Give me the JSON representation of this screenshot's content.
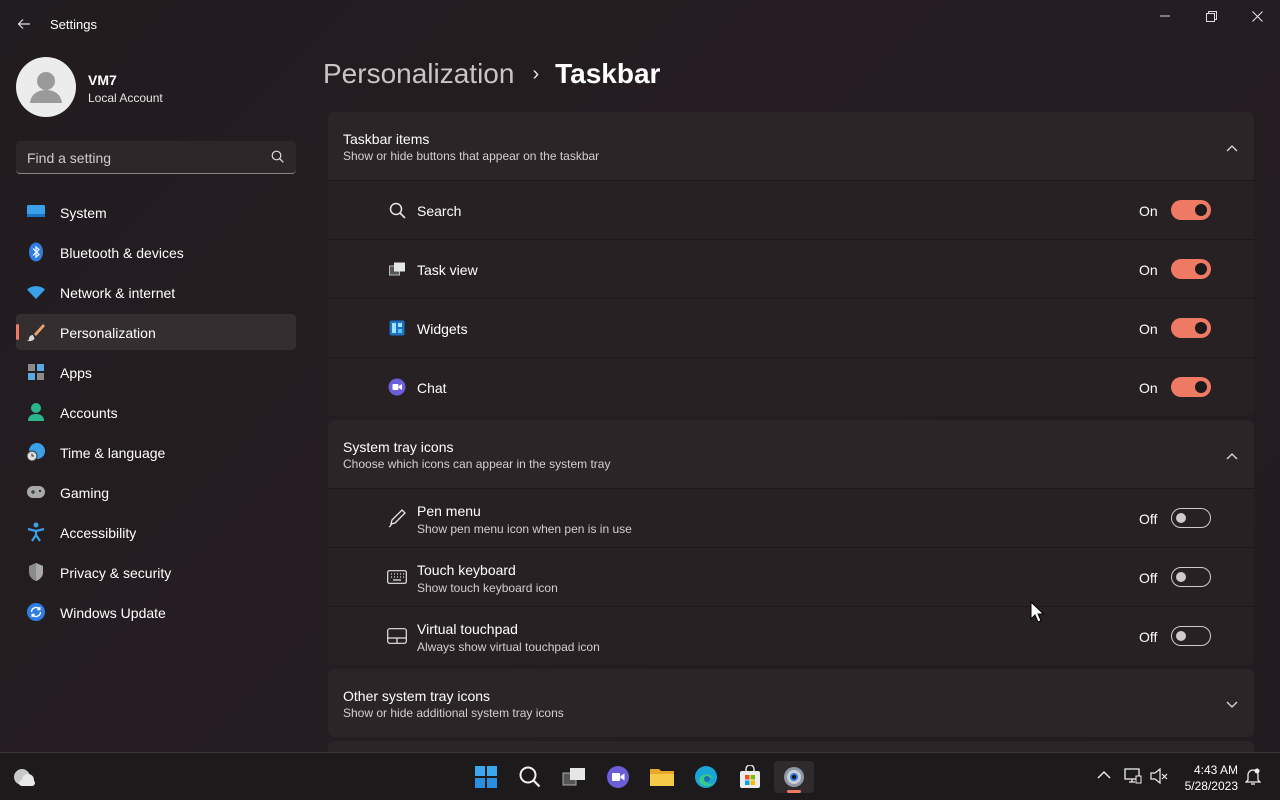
{
  "app": {
    "title": "Settings"
  },
  "user": {
    "name": "VM7",
    "account_type": "Local Account"
  },
  "search": {
    "placeholder": "Find a setting"
  },
  "sidebar": {
    "items": [
      {
        "label": "System",
        "icon": "system-icon",
        "active": false
      },
      {
        "label": "Bluetooth & devices",
        "icon": "bluetooth-icon",
        "active": false
      },
      {
        "label": "Network & internet",
        "icon": "wifi-icon",
        "active": false
      },
      {
        "label": "Personalization",
        "icon": "brush-icon",
        "active": true
      },
      {
        "label": "Apps",
        "icon": "apps-icon",
        "active": false
      },
      {
        "label": "Accounts",
        "icon": "accounts-icon",
        "active": false
      },
      {
        "label": "Time & language",
        "icon": "globe-clock-icon",
        "active": false
      },
      {
        "label": "Gaming",
        "icon": "gamepad-icon",
        "active": false
      },
      {
        "label": "Accessibility",
        "icon": "accessibility-icon",
        "active": false
      },
      {
        "label": "Privacy & security",
        "icon": "shield-icon",
        "active": false
      },
      {
        "label": "Windows Update",
        "icon": "update-icon",
        "active": false
      }
    ]
  },
  "breadcrumb": {
    "parent": "Personalization",
    "separator": "›",
    "current": "Taskbar"
  },
  "sections": {
    "taskbar_items": {
      "title": "Taskbar items",
      "description": "Show or hide buttons that appear on the taskbar",
      "expanded": true,
      "rows": [
        {
          "label": "Search",
          "state": "On",
          "on": true,
          "icon": "search-icon"
        },
        {
          "label": "Task view",
          "state": "On",
          "on": true,
          "icon": "task-view-icon"
        },
        {
          "label": "Widgets",
          "state": "On",
          "on": true,
          "icon": "widgets-icon"
        },
        {
          "label": "Chat",
          "state": "On",
          "on": true,
          "icon": "chat-icon"
        }
      ]
    },
    "system_tray": {
      "title": "System tray icons",
      "description": "Choose which icons can appear in the system tray",
      "expanded": true,
      "rows": [
        {
          "label": "Pen menu",
          "sublabel": "Show pen menu icon when pen is in use",
          "state": "Off",
          "on": false,
          "icon": "pen-icon"
        },
        {
          "label": "Touch keyboard",
          "sublabel": "Show touch keyboard icon",
          "state": "Off",
          "on": false,
          "icon": "keyboard-icon"
        },
        {
          "label": "Virtual touchpad",
          "sublabel": "Always show virtual touchpad icon",
          "state": "Off",
          "on": false,
          "icon": "touchpad-icon"
        }
      ]
    },
    "other_tray": {
      "title": "Other system tray icons",
      "description": "Show or hide additional system tray icons",
      "expanded": false
    }
  },
  "taskbar": {
    "apps": [
      "start-icon",
      "taskbar-search-icon",
      "task-view-icon",
      "teams-chat-icon",
      "file-explorer-icon",
      "edge-icon",
      "store-icon",
      "settings-icon"
    ],
    "active_app": "settings-icon",
    "clock": {
      "time": "4:43 AM",
      "date": "5/28/2023"
    }
  },
  "colors": {
    "accent": "#ef7a63",
    "background": "#211c1f",
    "card": "#2b2528"
  }
}
